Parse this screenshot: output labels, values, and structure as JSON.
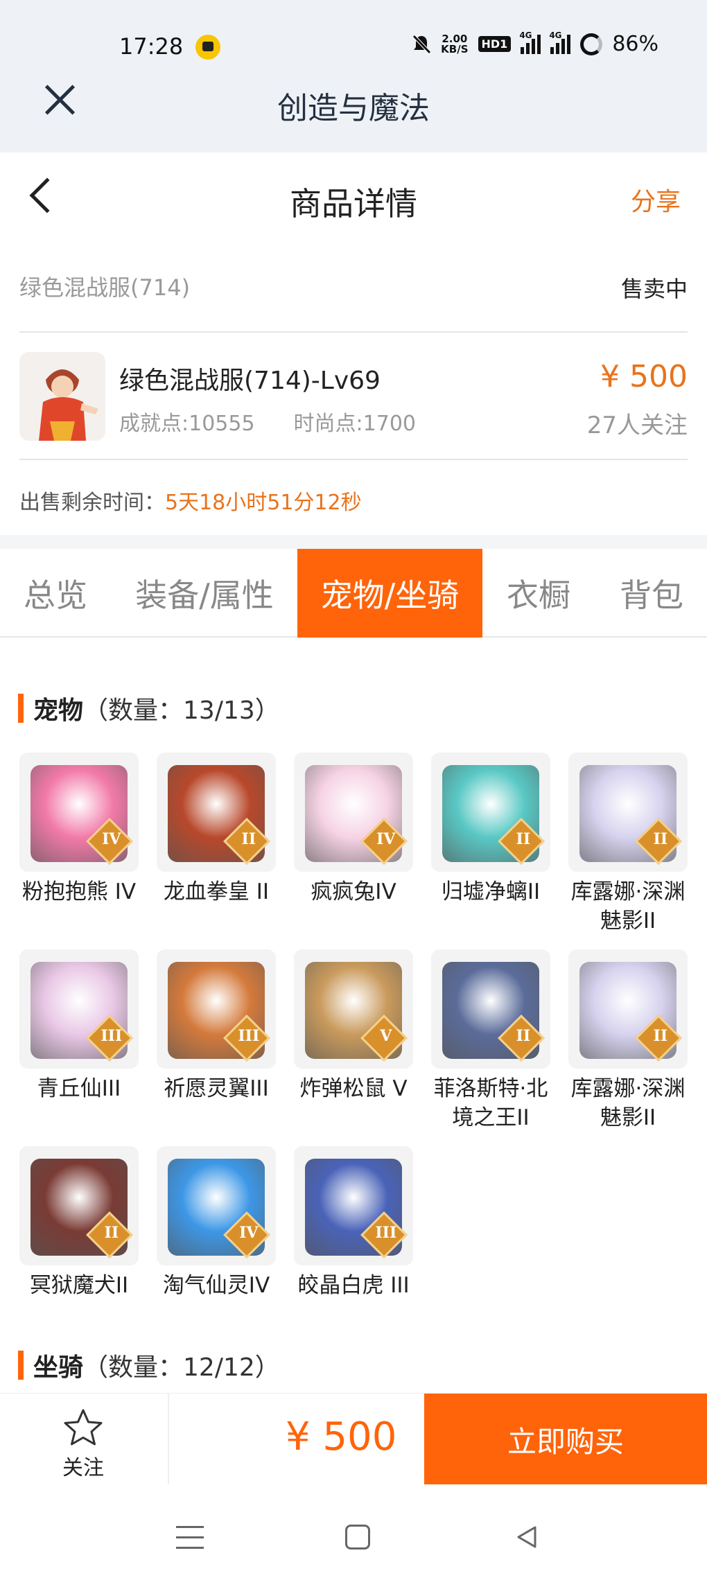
{
  "status_bar": {
    "time": "17:28",
    "speed": "2.00\nKB/S",
    "hd": "HD1",
    "net1": "4G",
    "net2": "4G",
    "battery": "86%"
  },
  "app_header": {
    "title": "创造与魔法"
  },
  "page_nav": {
    "title": "商品详情",
    "share": "分享"
  },
  "item": {
    "subtitle": "绿色混战服(714)",
    "status": "售卖中",
    "name": "绿色混战服(714)-Lv69",
    "achievement": "成就点:10555",
    "fashion": "时尚点:1700",
    "price": "¥ 500",
    "followers": "27人关注",
    "time_label": "出售剩余时间：",
    "time_value": "5天18小时51分12秒"
  },
  "tabs": [
    "总览",
    "装备/属性",
    "宠物/坐骑",
    "衣橱",
    "背包"
  ],
  "active_tab": 2,
  "pets_section": {
    "title": "宠物",
    "count": "（数量：13/13）"
  },
  "mounts_section": {
    "title": "坐骑",
    "count": "（数量：12/12）"
  },
  "pets": [
    {
      "name": "粉抱抱熊 IV",
      "grade": "IV",
      "color": "#f27aa8"
    },
    {
      "name": "龙血拳皇 II",
      "grade": "II",
      "color": "#b8482b"
    },
    {
      "name": "疯疯兔IV",
      "grade": "IV",
      "color": "#f6d3e4"
    },
    {
      "name": "归墟净螭II",
      "grade": "II",
      "color": "#58c8c4"
    },
    {
      "name": "库露娜·深渊魅影II",
      "grade": "II",
      "color": "#d7d2ee"
    },
    {
      "name": "青丘仙III",
      "grade": "III",
      "color": "#e9c8e6"
    },
    {
      "name": "祈愿灵翼III",
      "grade": "III",
      "color": "#d47a3c"
    },
    {
      "name": "炸弹松鼠 V",
      "grade": "V",
      "color": "#c99a5c"
    },
    {
      "name": "菲洛斯特·北境之王II",
      "grade": "II",
      "color": "#5b6c9a"
    },
    {
      "name": "库露娜·深渊魅影II",
      "grade": "II",
      "color": "#d7d2ee"
    },
    {
      "name": "冥狱魔犬II",
      "grade": "II",
      "color": "#7a3b35"
    },
    {
      "name": "淘气仙灵IV",
      "grade": "IV",
      "color": "#3d97e6"
    },
    {
      "name": "皎晶白虎 III",
      "grade": "III",
      "color": "#4a63b8"
    }
  ],
  "bottom_bar": {
    "follow_label": "关注",
    "price": "¥ 500",
    "buy_label": "立即购买"
  },
  "colors": {
    "accent": "#ff640a",
    "price_orange": "#e8731b"
  }
}
